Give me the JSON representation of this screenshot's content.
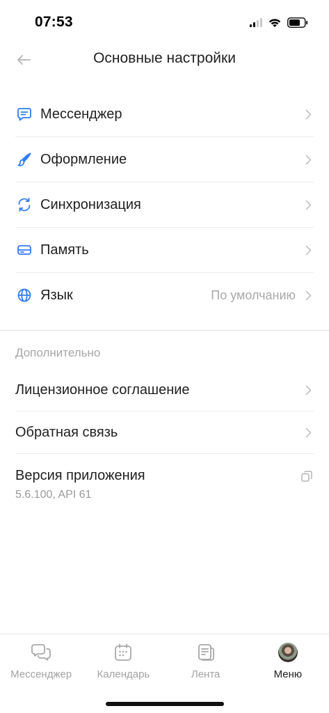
{
  "status_bar": {
    "time": "07:53"
  },
  "header": {
    "title": "Основные настройки"
  },
  "settings": {
    "items": [
      {
        "label": "Мессенджер",
        "icon": "chat-icon"
      },
      {
        "label": "Оформление",
        "icon": "brush-icon"
      },
      {
        "label": "Синхронизация",
        "icon": "sync-icon"
      },
      {
        "label": "Память",
        "icon": "storage-icon"
      },
      {
        "label": "Язык",
        "icon": "globe-icon",
        "value": "По умолчанию"
      }
    ]
  },
  "extra": {
    "section_title": "Дополнительно",
    "items": [
      {
        "label": "Лицензионное соглашение"
      },
      {
        "label": "Обратная связь"
      },
      {
        "label": "Версия приложения",
        "value": "5.6.100, API 61",
        "icon": "copy-icon"
      }
    ]
  },
  "tabs": [
    {
      "label": "Мессенджер",
      "icon": "chat-bubbles-icon",
      "active": false
    },
    {
      "label": "Календарь",
      "icon": "calendar-icon",
      "active": false
    },
    {
      "label": "Лента",
      "icon": "feed-icon",
      "active": false
    },
    {
      "label": "Меню",
      "icon": "avatar",
      "active": true
    }
  ],
  "colors": {
    "accent": "#2f7cf6",
    "text": "#1f1f1f",
    "secondary": "#a8a8a8"
  }
}
